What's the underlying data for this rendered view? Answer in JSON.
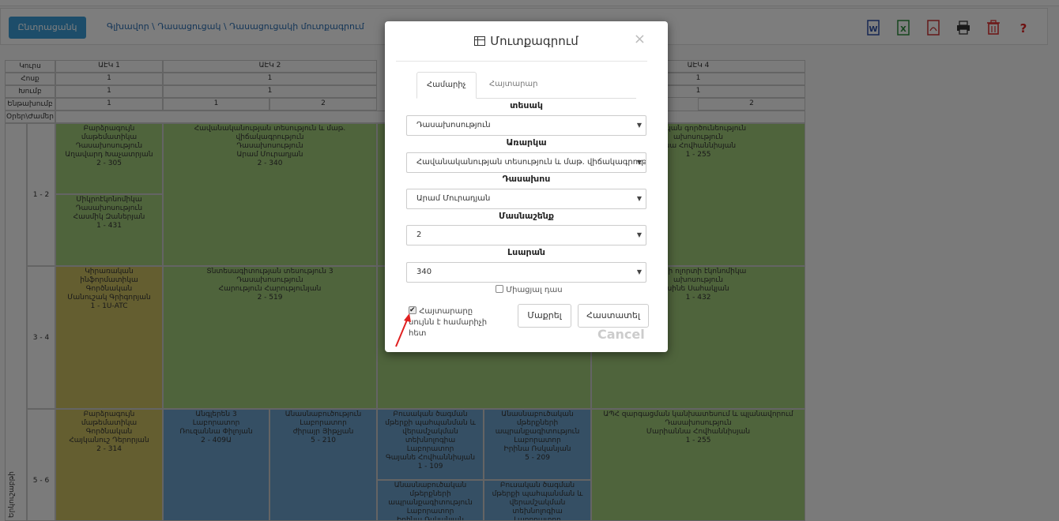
{
  "toolbar": {
    "back_label": "Ընտրացանկ",
    "breadcrumb": "Գլխավոր \\ Դասացուցակ \\ Դասացուցակի մուտքագրում",
    "icons": [
      "word-icon",
      "excel-icon",
      "pdf-icon",
      "print-icon",
      "trash-icon",
      "help-icon"
    ],
    "help_glyph": "?"
  },
  "grid": {
    "row_labels": [
      "Կուրս",
      "Հոսք",
      "Խումբ",
      "Ենթախումբ",
      "Օրեր\\Ժամեր"
    ],
    "courses": [
      "ԱԷԿ 1",
      "ԱԷԿ 2",
      "ԱԷԿ 4"
    ],
    "flow": [
      "1",
      "1",
      "1"
    ],
    "group": [
      "1",
      "1",
      "1"
    ],
    "subgroup": [
      "1",
      "1",
      "2",
      "2"
    ],
    "day": "Երկուշաբթի",
    "periods": [
      "1 - 2",
      "3 - 4",
      "5 - 6"
    ],
    "cells": {
      "c1": "Բարձրագույն\nմաթեմատիկա\nԴասախոսություն\nԱղավարդ Խաչատրյան\n2 - 305",
      "c2": "Միկրոէկոնոմիկա\nԴասախոսություն\nՀասմիկ Զաներյան\n1 - 431",
      "c3": "Հավանականության տեսություն և մաթ.\nվիճակագրություն\nԴասախոսություն\nԱրամ Մուրադյան\n2 - 340",
      "c4": "իրական գործունեություն\nախոսություն\nննա Հովհաննիսյան\n1 - 255",
      "c5": "Կիրառական\nինֆորմատիկա\nԳործնական\nՄանուշակ Գրիգորյան\n1 - 1Ս-ATC",
      "c6": "Տնտեսագիտության տեսություն 3\nԴասախոսություն\nՀարություն Հարությունյան\n2 - 519",
      "c7": "նների ոլորտի էկոնոմիկա\nախոսություն\nսինե Սահակյան\n1 - 432",
      "c8": "Բարձրագույն\nմաթեմատիկա\nԳործնական\nՀայկանուշ Դերորյան\n2 - 314",
      "c9": "Անգլերեն 3\nԼաբորատոր\nՌուզաննա Փիլոյան\n2 - 409Ա",
      "c10": "Անասնաբուծություն\nԼաբորատոր\nժիրայր Յիթչյան\n5 - 210",
      "c11": "Բուսական ծագման\nմթերքի պահպանման և\nվերամշակման\nտեխնոլոգիա\nԼաբորատոր\nԳայանե Հովհաննիսյան\n1 - 109",
      "c12": "Անասնաբուծական\nմթերքների\nապրանքագիտություն\nԼաբորատոր\nԻրինա Ռսկանյան\n5 - 209",
      "c13": "ԱՊՀ զարգացման կանխատեսում և պլանավորում\nԴասախոսություն\nՄարիաննա Հովհաննիսյան\n1 - 255",
      "c14": "Անասնաբուծական\nմթերքների\nապրանքագիտություն\nԼաբորատոր\nԻրինա Ռսկանյան",
      "c15": "Բուսական ծագման\nմթերքի պահպանման և\nվերամշակման\nտեխնոլոգիա\nԼաբորատոր"
    }
  },
  "modal": {
    "title": "Մուտքագրում",
    "close": "×",
    "tabs": [
      "Համարիչ",
      "Հայտարար"
    ],
    "fields": [
      {
        "label": "տեսակ",
        "value": "Դասախոսություն"
      },
      {
        "label": "Առարկա",
        "value": "Հավանականության տեսություն և մաթ. վիճակագրություն"
      },
      {
        "label": "Դասախոս",
        "value": "Արամ Մուրադյան"
      },
      {
        "label": "Մասնաշենք",
        "value": "2"
      },
      {
        "label": "Լսարան",
        "value": "340"
      }
    ],
    "single_class_label": "Միացյալ դաս",
    "same_as_label": "Հայտարարը նույնն է համարիչի հետ",
    "clear_label": "Մաքրել",
    "confirm_label": "Հաստատել",
    "cancel_label": "Cancel"
  }
}
